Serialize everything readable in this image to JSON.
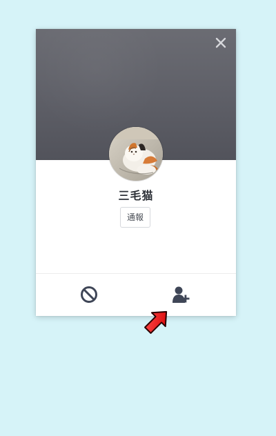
{
  "profile": {
    "name": "三毛猫",
    "report_label": "通報"
  },
  "icons": {
    "close": "close-icon",
    "block": "block-icon",
    "add_friend": "add-friend-icon",
    "avatar": "avatar"
  },
  "colors": {
    "page_background": "#d6f3f8",
    "cover_background": "#5f6068",
    "icon_dark": "#3f4657",
    "arrow": "#ff1a1a"
  }
}
